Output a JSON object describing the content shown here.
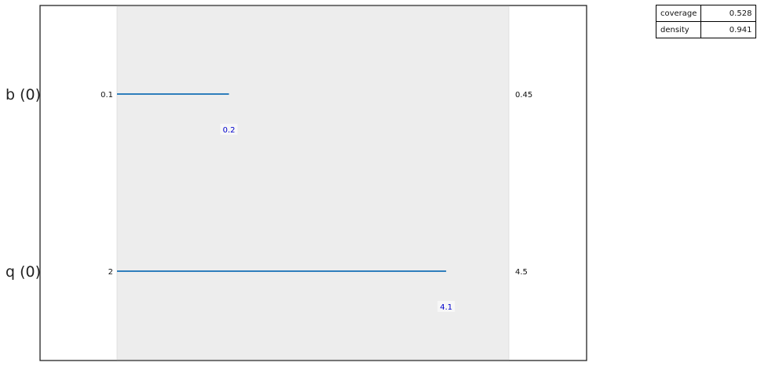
{
  "chart_data": {
    "type": "box-limits",
    "title": "",
    "xlabel": "",
    "ylabel": "",
    "grid": false,
    "rows": [
      {
        "label": "b (0)",
        "range_min": 0.1,
        "range_max": 0.45,
        "box_min": 0.1,
        "box_max": 0.2,
        "box_max_label": "0.2",
        "min_label": "0.1",
        "max_label": "0.45"
      },
      {
        "label": "q (0)",
        "range_min": 2,
        "range_max": 4.5,
        "box_min": 2,
        "box_max": 4.1,
        "box_max_label": "4.1",
        "min_label": "2",
        "max_label": "4.5"
      }
    ],
    "stats": [
      {
        "name": "coverage",
        "value": "0.528"
      },
      {
        "name": "density",
        "value": "0.941"
      }
    ],
    "colors": {
      "line": "#2f7ebc",
      "annotation": "#0000cc",
      "band": "#ededed",
      "frame": "#222222"
    }
  }
}
